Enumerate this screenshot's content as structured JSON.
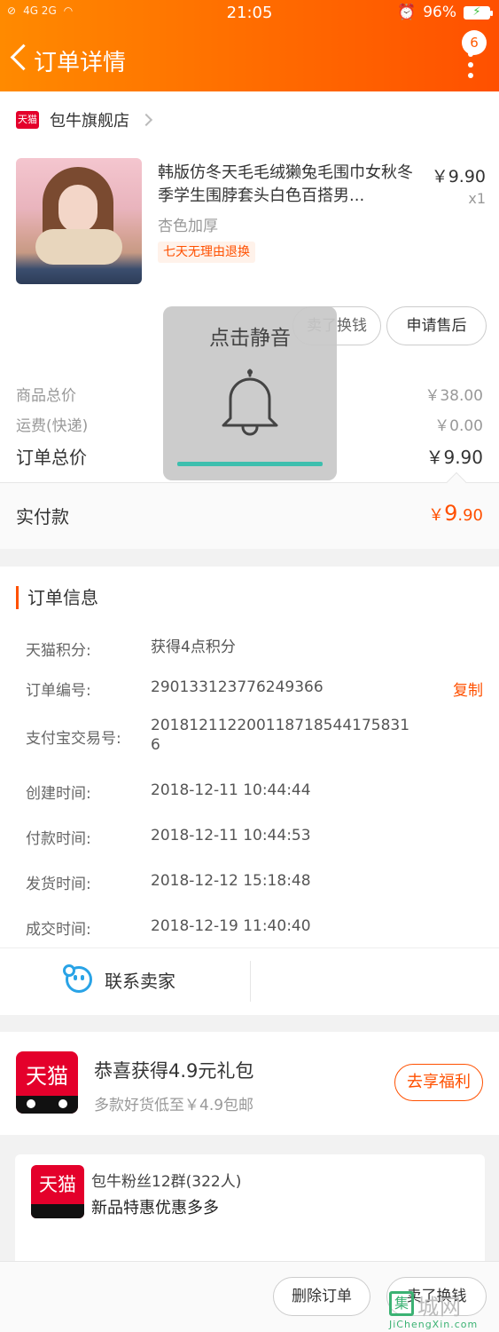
{
  "status_bar": {
    "signal": "4G 2G",
    "time": "21:05",
    "battery": "96%"
  },
  "header": {
    "title": "订单详情",
    "badge": "6"
  },
  "store": {
    "logo_text": "天猫",
    "name": "包牛旗舰店"
  },
  "product": {
    "title": "韩版仿冬天毛毛绒獭兔毛围巾女秋冬季学生围脖套头白色百搭男...",
    "price": "￥9.90",
    "quantity": "x1",
    "sku": "杏色加厚",
    "tag": "七天无理由退换"
  },
  "actions": {
    "sell": "卖了换钱",
    "after_sale": "申请售后"
  },
  "summary": {
    "goods_label": "商品总价",
    "goods_value": "￥38.00",
    "freight_label": "运费(快递)",
    "freight_value": "￥0.00",
    "total_label": "订单总价",
    "total_value": "￥9.90"
  },
  "payment": {
    "label": "实付款",
    "currency": "￥",
    "int": "9",
    "dec": ".90"
  },
  "mute_overlay": {
    "text": "点击静音",
    "icon": "bell-icon",
    "accent": "#3dbfae"
  },
  "order_info": {
    "title": "订单信息",
    "rows": [
      {
        "k": "天猫积分:",
        "v": "获得4点积分"
      },
      {
        "k": "订单编号:",
        "v": "290133123776249366",
        "action": "复制"
      },
      {
        "k": "支付宝交易号:",
        "v": "2018121122001187185441758316"
      },
      {
        "k": "创建时间:",
        "v": "2018-12-11 10:44:44"
      },
      {
        "k": "付款时间:",
        "v": "2018-12-11 10:44:53"
      },
      {
        "k": "发货时间:",
        "v": "2018-12-12 15:18:48"
      },
      {
        "k": "成交时间:",
        "v": "2018-12-19 11:40:40"
      }
    ],
    "contact": "联系卖家"
  },
  "gift": {
    "logo_text": "天猫",
    "title": "恭喜获得4.9元礼包",
    "subtitle": "多款好货低至￥4.9包邮",
    "button": "去享福利"
  },
  "fan_group": {
    "logo_text": "天猫",
    "name": "包牛粉丝12群(322人)",
    "desc": "新品特惠优惠多多"
  },
  "bottom": {
    "delete": "删除订单",
    "sell": "卖了换钱"
  },
  "watermark": {
    "logo": "集",
    "name": "城网",
    "url": "JiChengXin.com"
  },
  "colors": {
    "brand": "#ff5000",
    "tmall_red": "#e4002b",
    "header_gradient_start": "#ff8a00"
  }
}
